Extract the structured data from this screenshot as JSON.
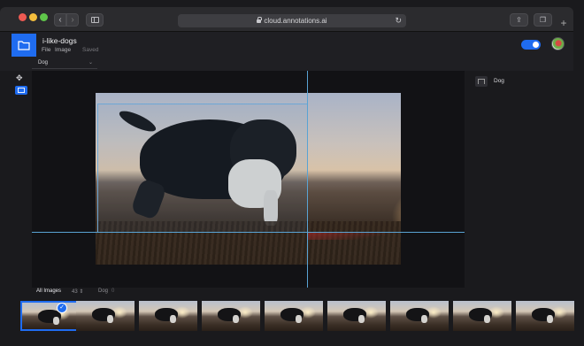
{
  "browser": {
    "url": "cloud.annotations.ai",
    "back_glyph": "‹",
    "forward_glyph": "›",
    "reload_glyph": "↻",
    "share_glyph": "⇪",
    "tabs_glyph": "❐",
    "newtab_glyph": "+"
  },
  "app": {
    "project_title": "i-like-dogs",
    "menu": {
      "file": "File",
      "image": "Image"
    },
    "save_status": "Saved",
    "accent_color": "#1f6cf0",
    "label_select": {
      "value": "Dog",
      "chevron": "⌄"
    }
  },
  "tools": {
    "move_glyph": "✥",
    "box_tool": "bounding-box-tool"
  },
  "labels_panel": {
    "items": [
      {
        "name": "Dog"
      }
    ]
  },
  "filter_bar": {
    "all_images": "All Images",
    "count": "43 ⇕",
    "dog_filter": "Dog",
    "dog_count": "0"
  },
  "filmstrip": {
    "selected_index": 0,
    "thumbnail_count": 9,
    "check_glyph": "✓"
  }
}
